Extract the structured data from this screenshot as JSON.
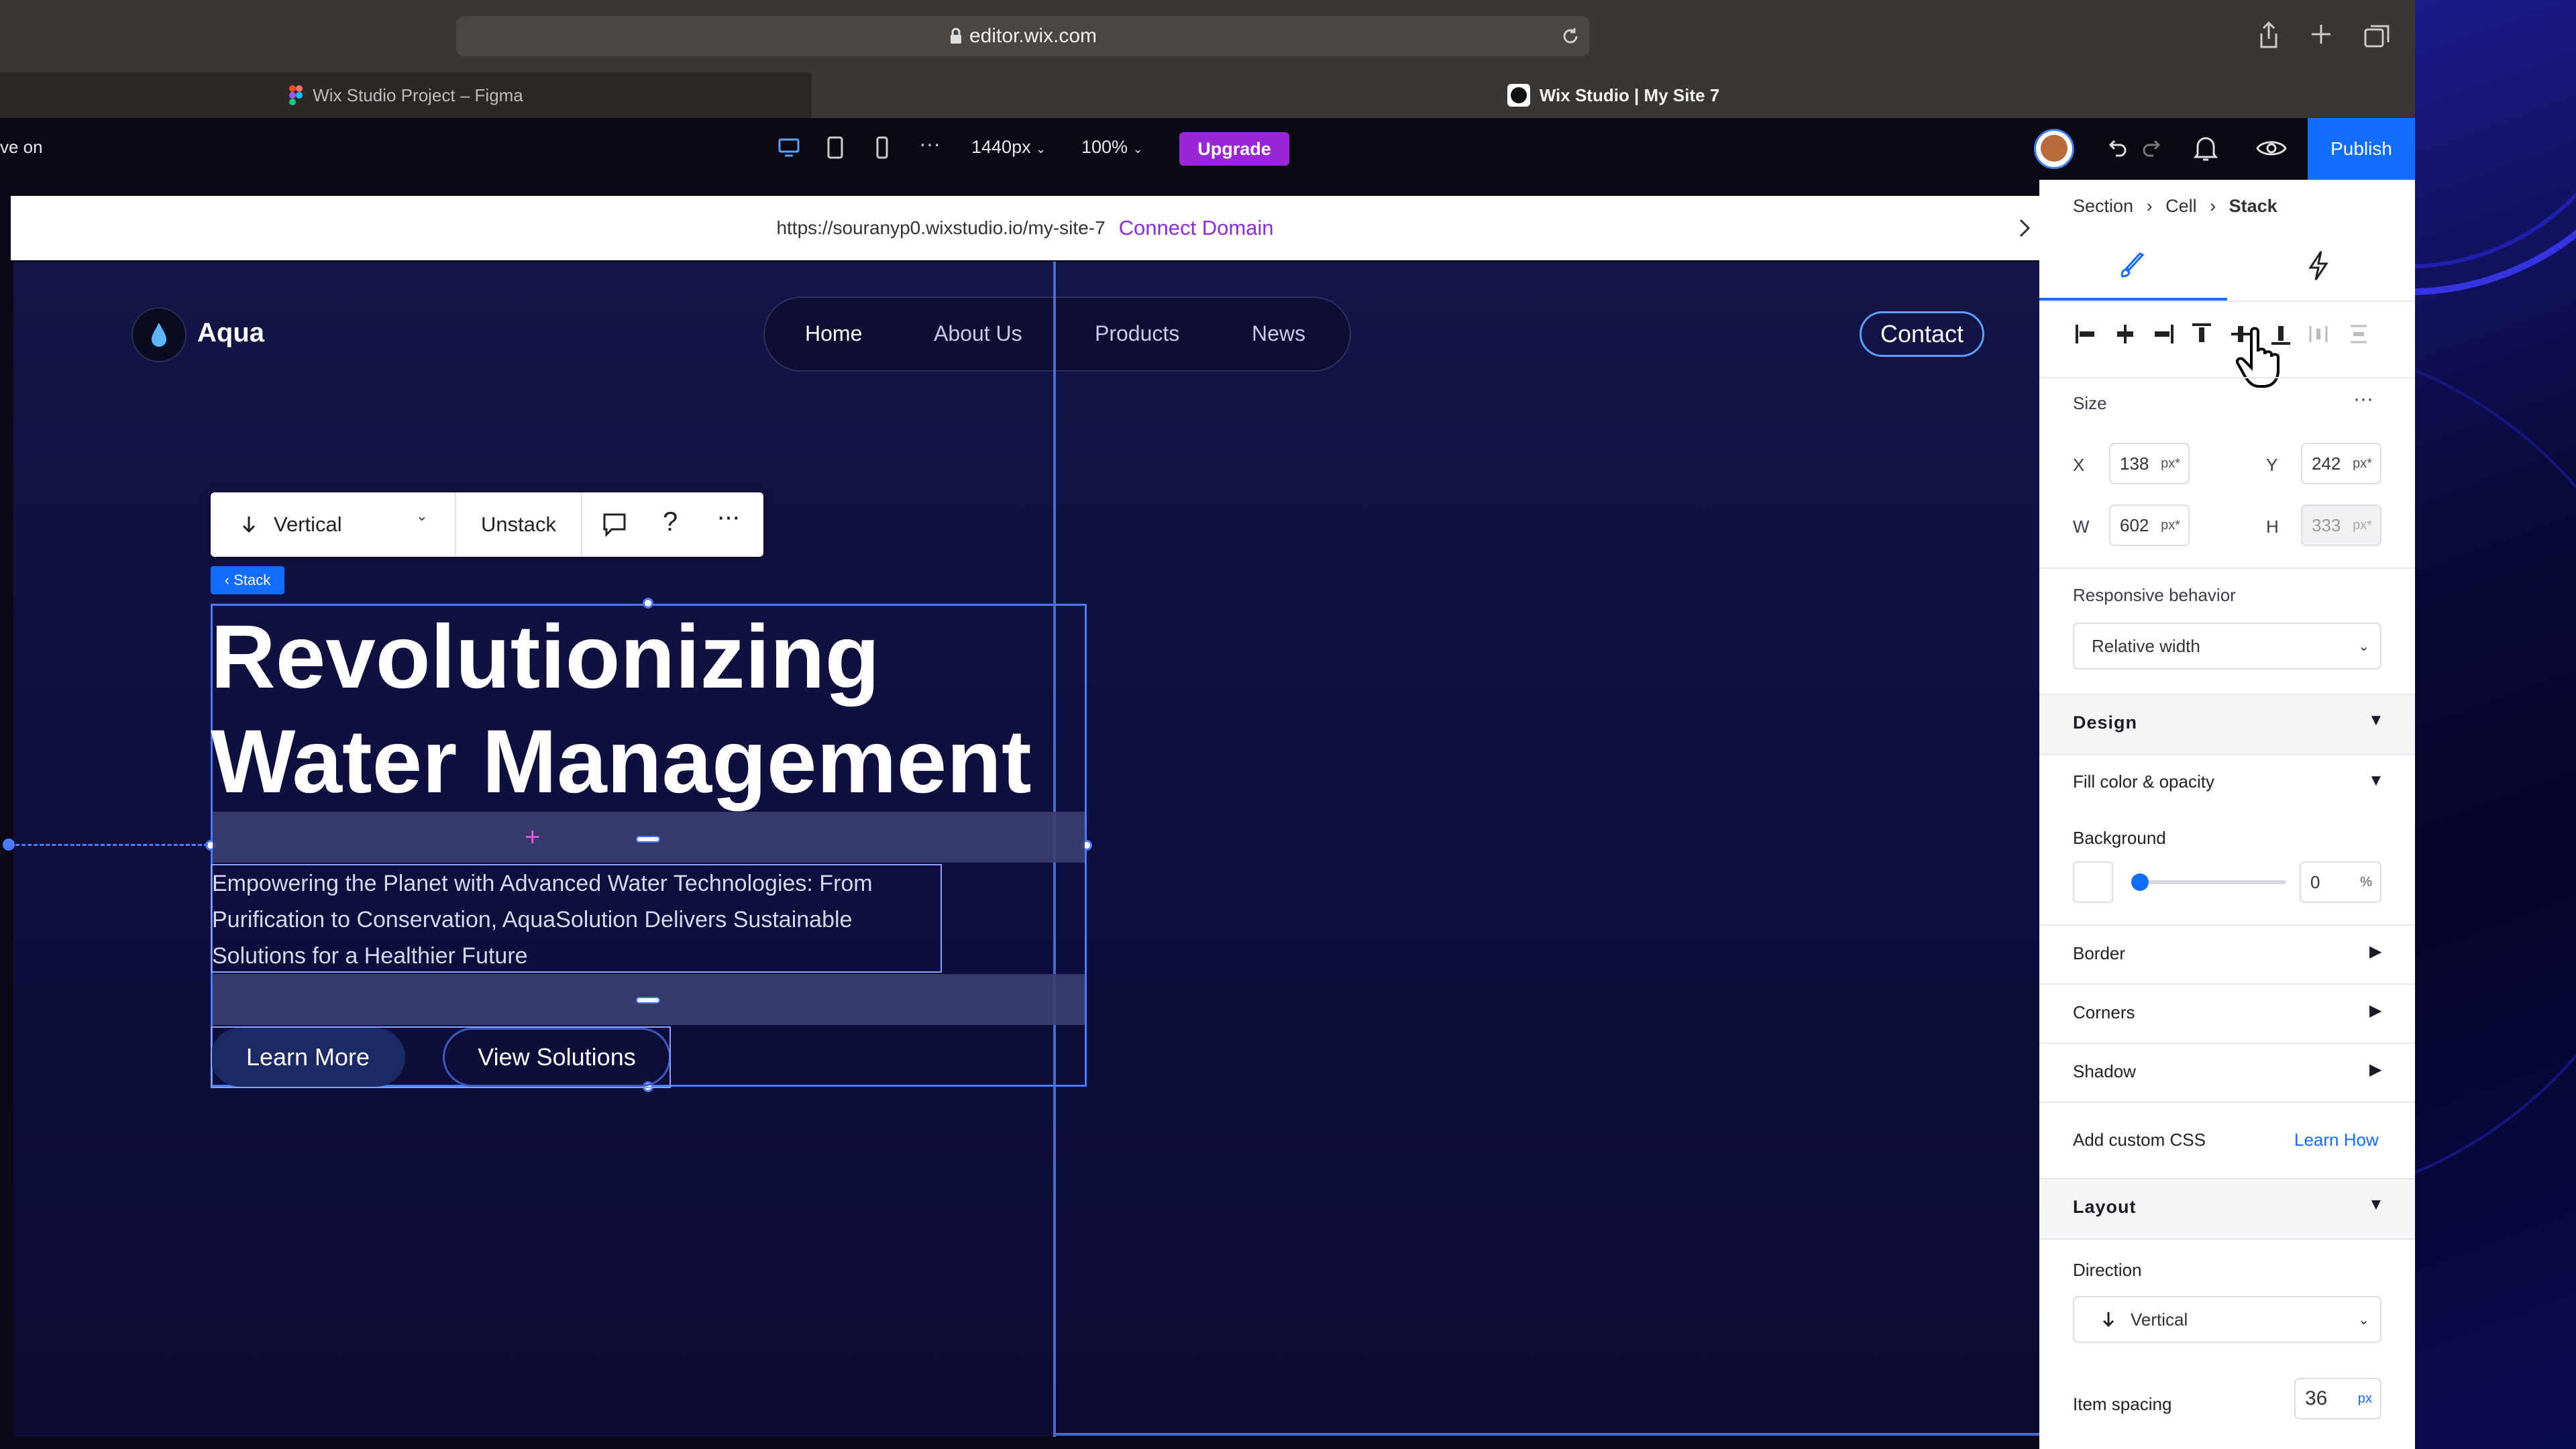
{
  "browser": {
    "url": "editor.wix.com",
    "tabs": [
      {
        "label": "Wix Studio Project – Figma"
      },
      {
        "label": "Wix Studio | My Site 7"
      }
    ]
  },
  "editor_toolbar": {
    "left_text": "ve on",
    "width_value": "1440px",
    "zoom_value": "100%",
    "upgrade_label": "Upgrade",
    "publish_label": "Publish"
  },
  "site_url_bar": {
    "url": "https://souranyp0.wixstudio.io/my-site-7",
    "connect_label": "Connect Domain"
  },
  "site": {
    "brand": "Aqua",
    "nav": [
      "Home",
      "About Us",
      "Products",
      "News"
    ],
    "contact_label": "Contact",
    "hero_line1": "Revolutionizing",
    "hero_line2": "Water Management",
    "paragraph_line1": "Empowering the Planet with Advanced Water Technologies: From",
    "paragraph_line2": "Purification to Conservation, AquaSolution Delivers Sustainable",
    "paragraph_line3": "Solutions for a Healthier Future",
    "btn_primary": "Learn More",
    "btn_secondary": "View Solutions"
  },
  "floating_toolbar": {
    "direction_label": "Vertical",
    "unstack_label": "Unstack",
    "help_label": "?",
    "stack_tag": "‹ Stack"
  },
  "panel": {
    "breadcrumb": [
      "Section",
      "Cell",
      "Stack"
    ],
    "size_label": "Size",
    "x_label": "X",
    "x_value": "138",
    "y_label": "Y",
    "y_value": "242",
    "w_label": "W",
    "w_value": "602",
    "h_label": "H",
    "h_value": "333",
    "unit_px_star": "px*",
    "responsive_label": "Responsive behavior",
    "responsive_value": "Relative width",
    "design_label": "Design",
    "fill_label": "Fill color & opacity",
    "background_label": "Background",
    "opacity_value": "0",
    "opacity_unit": "%",
    "border_label": "Border",
    "corners_label": "Corners",
    "shadow_label": "Shadow",
    "custom_css_label": "Add custom CSS",
    "learn_how_label": "Learn How",
    "layout_label": "Layout",
    "direction_label": "Direction",
    "direction_value": "Vertical",
    "item_spacing_label": "Item spacing",
    "item_spacing_value": "36",
    "item_spacing_unit": "px"
  },
  "colors": {
    "accent_blue": "#116dff",
    "upgrade_purple": "#9a27d5",
    "site_bg": "#0f1040"
  }
}
